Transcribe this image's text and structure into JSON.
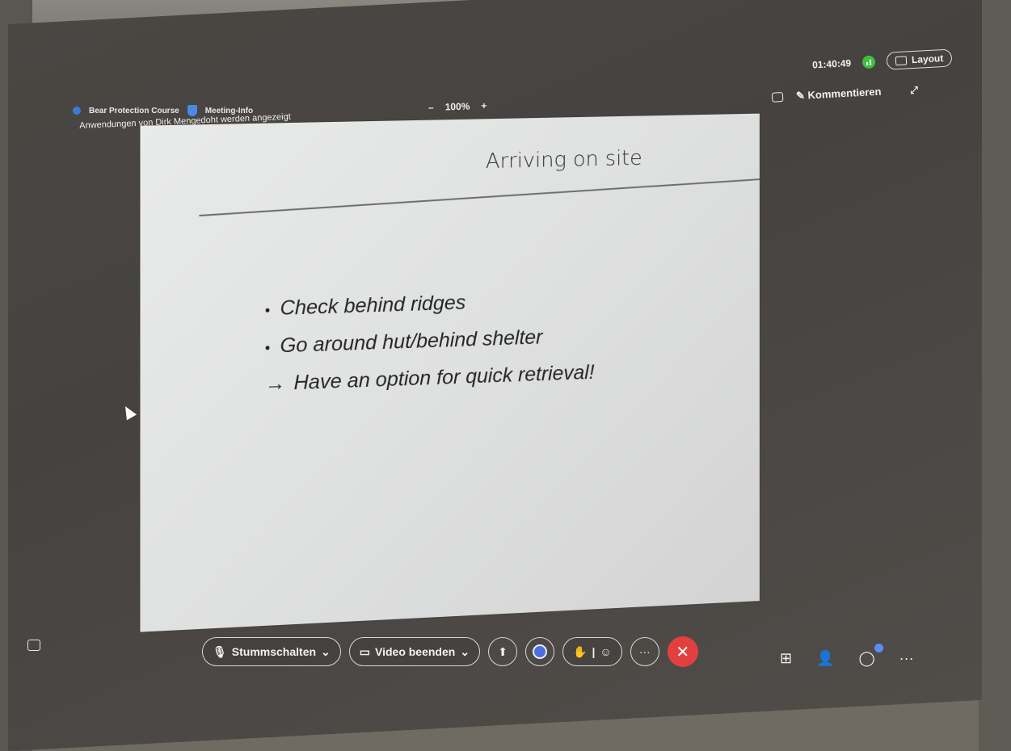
{
  "meeting": {
    "title": "Bear Protection Course",
    "info_label": "Meeting-Info",
    "sharing_text": "Anwendungen von Dirk Mengedoht werden angezeigt"
  },
  "zoom": {
    "minus": "–",
    "value": "100%",
    "plus": "+"
  },
  "status": {
    "timer": "01:40:49",
    "layout_label": "Layout"
  },
  "annotate": {
    "label": "Kommentieren"
  },
  "slide": {
    "title": "Arriving on site",
    "bullets": [
      "Check behind ridges",
      "Go around hut/behind shelter"
    ],
    "conclusion": "Have an option for quick retrieval!"
  },
  "toolbar": {
    "mute_label": "Stummschalten",
    "video_label": "Video beenden",
    "more_label": "···",
    "hangup_label": "✕"
  },
  "right": {
    "more_label": "···"
  }
}
